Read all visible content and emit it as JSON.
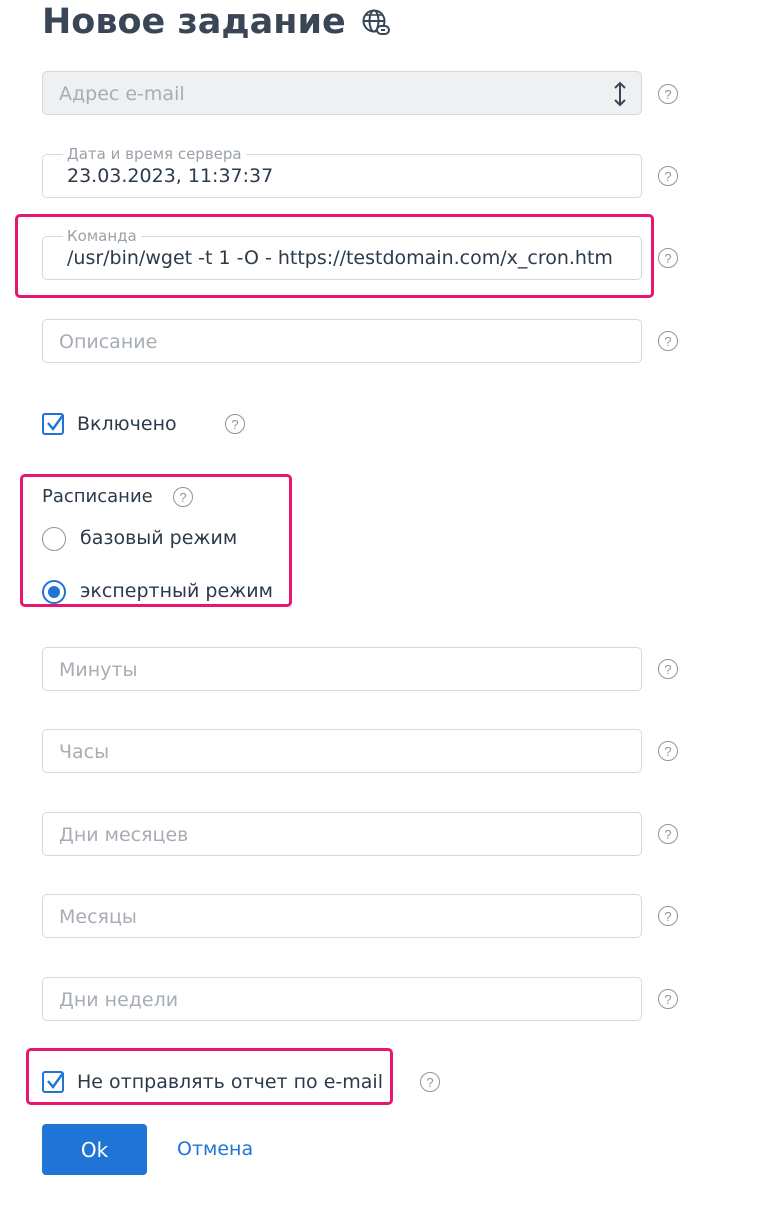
{
  "page": {
    "title": "Новое задание"
  },
  "form": {
    "email": {
      "placeholder": "Адрес e-mail"
    },
    "server_time": {
      "legend": "Дата и время сервера",
      "value": "23.03.2023, 11:37:37"
    },
    "command": {
      "legend": "Команда",
      "value": "/usr/bin/wget -t 1 -O - https://testdomain.com/x_cron.htm"
    },
    "description": {
      "placeholder": "Описание"
    },
    "enabled": {
      "label": "Включено",
      "checked": true
    },
    "schedule": {
      "label": "Расписание",
      "options": [
        {
          "label": "базовый режим",
          "selected": false
        },
        {
          "label": "экспертный режим",
          "selected": true
        }
      ]
    },
    "minutes": {
      "placeholder": "Минуты"
    },
    "hours": {
      "placeholder": "Часы"
    },
    "month_days": {
      "placeholder": "Дни месяцев"
    },
    "months": {
      "placeholder": "Месяцы"
    },
    "week_days": {
      "placeholder": "Дни недели"
    },
    "no_email_report": {
      "label": "Не отправлять отчет по e-mail",
      "checked": true
    }
  },
  "actions": {
    "ok_label": "Ok",
    "cancel_label": "Отмена"
  },
  "help_glyph": "?",
  "colors": {
    "accent": "#1f74d6",
    "highlight": "#e8166f",
    "title": "#3a4656"
  },
  "icons": {
    "title_icon": "globe-link-icon",
    "select_icon": "sort-arrows-icon",
    "help_icon": "help-circle-icon"
  }
}
